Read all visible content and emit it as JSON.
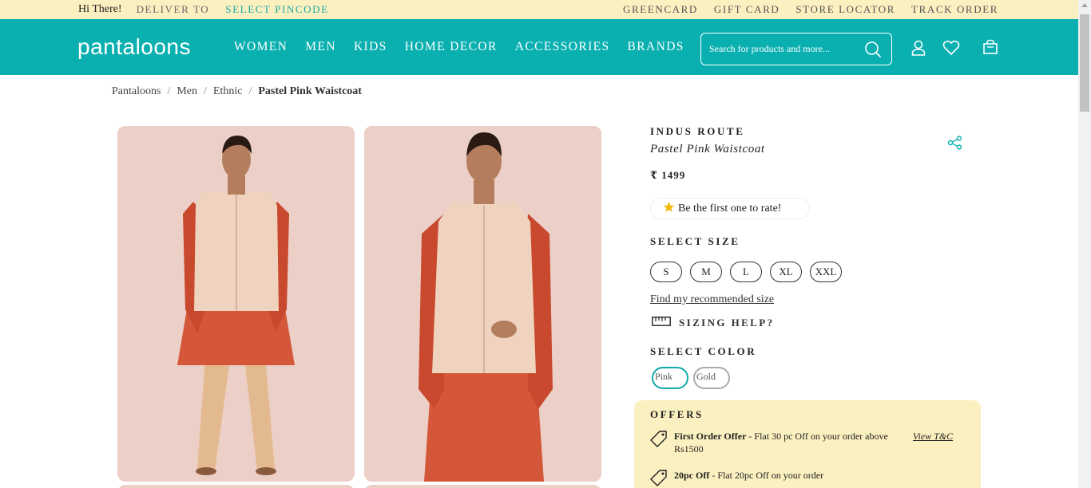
{
  "topbar": {
    "greeting": "Hi There!",
    "deliver_to": "DELIVER TO",
    "select_pincode": "SELECT PINCODE",
    "links": [
      "GREENCARD",
      "GIFT CARD",
      "STORE LOCATOR",
      "TRACK ORDER"
    ]
  },
  "header": {
    "logo": "pantaloons",
    "nav": [
      "WOMEN",
      "MEN",
      "KIDS",
      "HOME DECOR",
      "ACCESSORIES",
      "BRANDS"
    ],
    "search_placeholder": "Search for products and more...",
    "accent_color": "#0ab0b0"
  },
  "breadcrumb": [
    "Pantaloons",
    "Men",
    "Ethnic",
    "Pastel Pink Waistcoat"
  ],
  "product": {
    "brand": "INDUS ROUTE",
    "name": "Pastel Pink Waistcoat",
    "price": "₹ 1499",
    "rating_prompt": "Be the first one to rate!",
    "select_size_label": "SELECT SIZE",
    "sizes": [
      "S",
      "M",
      "L",
      "XL",
      "XXL"
    ],
    "find_size_link": "Find my recommended size",
    "sizing_help": "SIZING HELP?",
    "select_color_label": "SELECT COLOR",
    "colors": [
      "Pink",
      "Gold"
    ],
    "selected_color": "Pink"
  },
  "offers": {
    "title": "OFFERS",
    "items": [
      {
        "bold": "First Order Offer",
        "text": " - Flat 30 pc Off on your order above Rs1500",
        "link": "View T&C"
      },
      {
        "bold": "20pc Off",
        "text": " - Flat 20pc Off on your order"
      }
    ]
  }
}
